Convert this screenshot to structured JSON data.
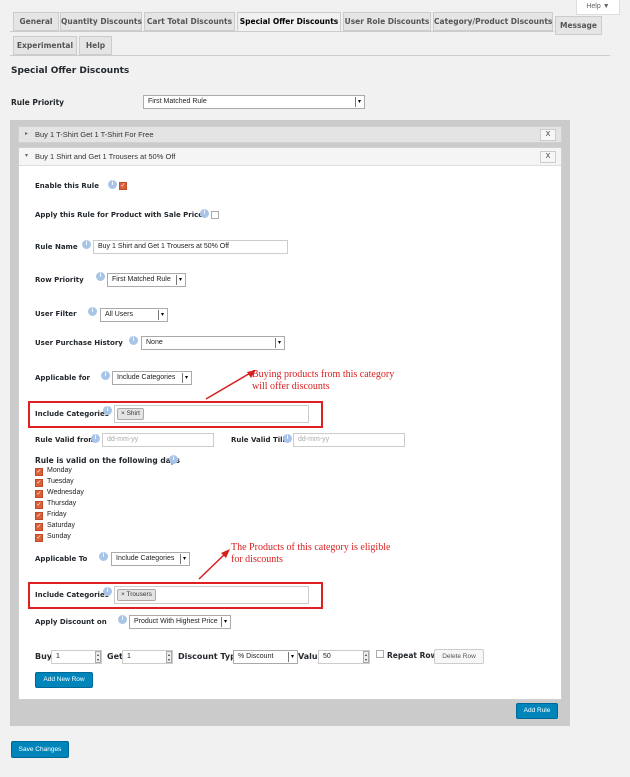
{
  "help_label": "Help ▼",
  "tabs": [
    {
      "label": "General"
    },
    {
      "label": "Quantity Discounts"
    },
    {
      "label": "Cart Total Discounts"
    },
    {
      "label": "Special Offer Discounts"
    },
    {
      "label": "User Role Discounts"
    },
    {
      "label": "Category/Product Discounts"
    },
    {
      "label": "Message"
    },
    {
      "label": "Experimental"
    },
    {
      "label": "Help"
    }
  ],
  "page_title": "Special Offer Discounts",
  "rule_priority": {
    "label": "Rule Priority",
    "value": "First Matched Rule"
  },
  "rules": [
    {
      "title": "Buy 1 T-Shirt Get 1 T-Shirt For Free",
      "close": "X"
    },
    {
      "title": "Buy 1 Shirt and Get 1 Trousers at 50% Off",
      "close": "X"
    }
  ],
  "form": {
    "enable_label": "Enable this Rule",
    "sale_label": "Apply this Rule for Product with Sale Price",
    "rule_name_label": "Rule Name",
    "rule_name_value": "Buy 1 Shirt and Get 1 Trousers at 50% Off",
    "row_priority_label": "Row Priority",
    "row_priority_value": "First Matched Rule",
    "user_filter_label": "User Filter",
    "user_filter_value": "All Users",
    "purchase_history_label": "User Purchase History",
    "purchase_history_value": "None",
    "applicable_for_label": "Applicable for",
    "applicable_for_value": "Include Categories",
    "include_categories_label": "Include Categories",
    "include_for_tag": "× Shirt",
    "valid_from_label": "Rule Valid from",
    "valid_from_placeholder": "dd-mm-yy",
    "valid_till_label": "Rule Valid Till",
    "valid_till_placeholder": "dd-mm-yy",
    "days_label": "Rule is valid on the following days",
    "days": [
      "Monday",
      "Tuesday",
      "Wednesday",
      "Thursday",
      "Friday",
      "Saturday",
      "Sunday"
    ],
    "applicable_to_label": "Applicable To",
    "applicable_to_value": "Include Categories",
    "include_to_tag": "× Trousers",
    "apply_discount_label": "Apply Discount on",
    "apply_discount_value": "Product With Highest Price",
    "buy_label": "Buy",
    "buy_value": "1",
    "get_label": "Get",
    "get_value": "1",
    "discount_type_label": "Discount Type",
    "discount_type_value": "% Discount",
    "value_label": "Value",
    "value_value": "50",
    "repeat_label": "Repeat Row",
    "delete_row": "Delete Row",
    "add_new_row": "Add New Row"
  },
  "annotations": {
    "for_line1": "Buying products from this category",
    "for_line2": "will offer discounts",
    "to_line1": "The Products of this category is eligible",
    "to_line2": "for discounts"
  },
  "add_rule": "Add Rule",
  "save_changes": "Save Changes",
  "colors": {
    "accent": "#0085ba",
    "annotation": "#d81e1e",
    "checkbox": "#d9603b"
  }
}
